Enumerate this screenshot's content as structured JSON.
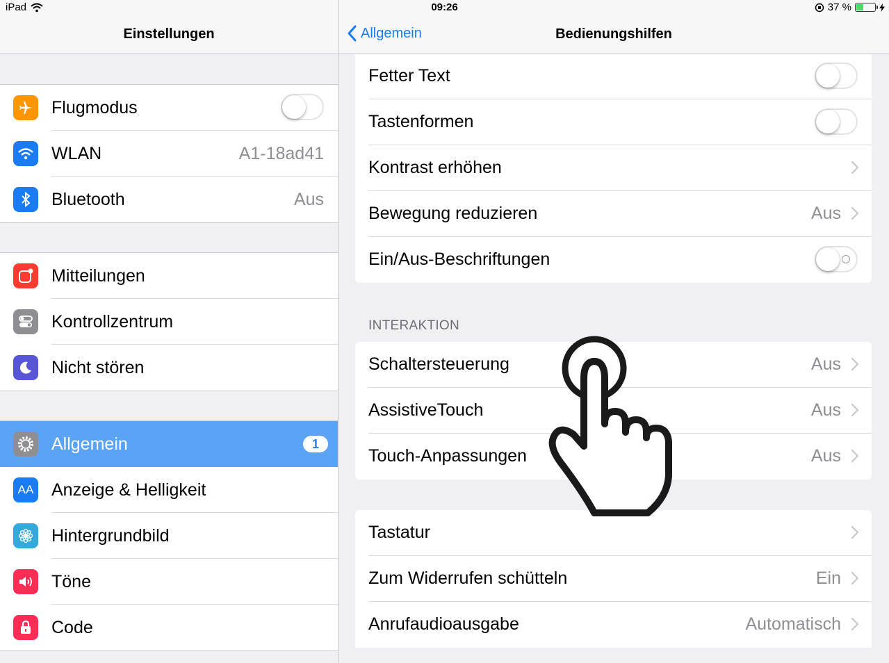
{
  "status_bar": {
    "device": "iPad",
    "time": "09:26",
    "battery_text": "37 %",
    "battery_level": 0.37
  },
  "left_pane": {
    "title": "Einstellungen",
    "groups": [
      [
        {
          "icon": "airplane-icon",
          "color": "#ff9500",
          "label": "Flugmodus",
          "toggle": false
        },
        {
          "icon": "wifi-icon",
          "color": "#1a7cf5",
          "label": "WLAN",
          "value": "A1-18ad41"
        },
        {
          "icon": "bluetooth-icon",
          "color": "#1a7cf5",
          "label": "Bluetooth",
          "value": "Aus"
        }
      ],
      [
        {
          "icon": "notifications-icon",
          "color": "#ff3b30",
          "label": "Mitteilungen"
        },
        {
          "icon": "control-center-icon",
          "color": "#8e8e93",
          "label": "Kontrollzentrum"
        },
        {
          "icon": "moon-icon",
          "color": "#5856d6",
          "label": "Nicht stören"
        }
      ],
      [
        {
          "icon": "gear-icon",
          "color": "#8e8e93",
          "label": "Allgemein",
          "badge": "1",
          "selected": true
        },
        {
          "icon": "display-icon",
          "color": "#1a7cf5",
          "label": "Anzeige & Helligkeit",
          "icon_text": "AA"
        },
        {
          "icon": "wallpaper-icon",
          "color": "#34aadc",
          "label": "Hintergrundbild"
        },
        {
          "icon": "sound-icon",
          "color": "#ff2d55",
          "label": "Töne"
        },
        {
          "icon": "lock-icon",
          "color": "#ff2d55",
          "label": "Code"
        }
      ]
    ]
  },
  "right_pane": {
    "back_label": "Allgemein",
    "title": "Bedienungshilfen",
    "top_rows": [
      {
        "label": "Fetter Text",
        "toggle": false
      },
      {
        "label": "Tastenformen",
        "toggle": false
      },
      {
        "label": "Kontrast erhöhen",
        "chevron": true
      },
      {
        "label": "Bewegung reduzieren",
        "value": "Aus",
        "chevron": true
      },
      {
        "label": "Ein/Aus-Beschriftungen",
        "toggle": false,
        "onoff_label": true
      }
    ],
    "interaction_header": "INTERAKTION",
    "interaction_rows": [
      {
        "label": "Schaltersteuerung",
        "value": "Aus",
        "chevron": true
      },
      {
        "label": "AssistiveTouch",
        "value": "Aus",
        "chevron": true
      },
      {
        "label": "Touch-Anpassungen",
        "value": "Aus",
        "chevron": true
      }
    ],
    "other_rows": [
      {
        "label": "Tastatur",
        "chevron": true
      },
      {
        "label": "Zum Widerrufen schütteln",
        "value": "Ein",
        "chevron": true
      },
      {
        "label": "Anrufaudioausgabe",
        "value": "Automatisch",
        "chevron": true
      }
    ]
  }
}
